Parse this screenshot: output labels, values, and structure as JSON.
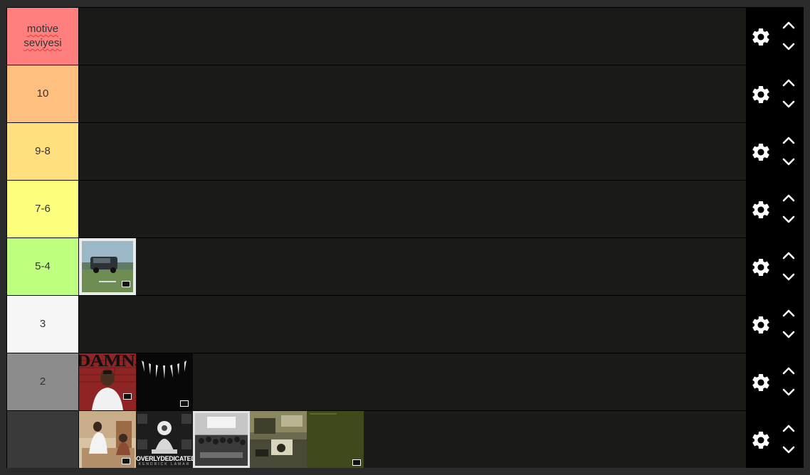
{
  "tiers": [
    {
      "label_line1": "motive",
      "label_line2": "seviyesi",
      "color": "#ff7f7f",
      "covers": []
    },
    {
      "label_line1": "10",
      "label_line2": "",
      "color": "#ffbf7f",
      "covers": []
    },
    {
      "label_line1": "9-8",
      "label_line2": "",
      "color": "#ffdf7f",
      "covers": []
    },
    {
      "label_line1": "7-6",
      "label_line2": "",
      "color": "#ffff7f",
      "covers": []
    },
    {
      "label_line1": "5-4",
      "label_line2": "",
      "color": "#bfff7f",
      "covers": [
        "good-kid-maad-city"
      ]
    },
    {
      "label_line1": "3",
      "label_line2": "",
      "color": "#f7f7f7",
      "covers": []
    },
    {
      "label_line1": "2",
      "label_line2": "",
      "color": "#8c8c8c",
      "covers": [
        "damn",
        "black-panther"
      ]
    },
    {
      "label_line1": "",
      "label_line2": "",
      "color": "#3a3a3a",
      "covers": [
        "mr-morale",
        "overly-dedicated",
        "to-pimp-a-butterfly",
        "section-80",
        "untitled-unmastered"
      ]
    }
  ],
  "cover_text": {
    "damn": "DAMN.",
    "overly_dedicated_title": "OVERLYDEDICATED",
    "overly_dedicated_artist": "KENDRICK LAMAR"
  },
  "icons": {
    "settings": "gear-icon",
    "move_up": "chevron-up-icon",
    "move_down": "chevron-down-icon"
  }
}
